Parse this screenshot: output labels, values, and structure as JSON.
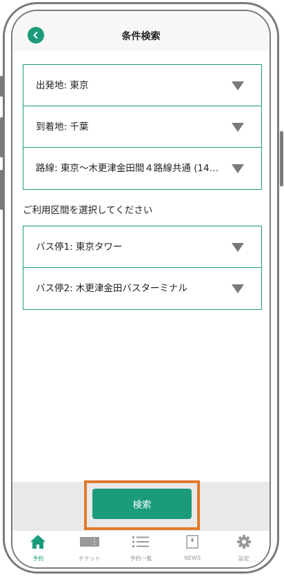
{
  "colors": {
    "primary": "#1a9b79",
    "highlight": "#e07a2a",
    "caret": "#7a7a7a",
    "inactive_tab": "#999999"
  },
  "header": {
    "title": "条件検索",
    "back_icon": "chevron-left-icon"
  },
  "route_selects": [
    {
      "label": "出発地: 東京"
    },
    {
      "label": "到着地: 千葉"
    },
    {
      "label": "路線: 東京～木更津金田間４路線共通 (14…"
    }
  ],
  "section": {
    "label": "ご利用区間を選択してください"
  },
  "stop_selects": [
    {
      "label": "バス停1: 東京タワー"
    },
    {
      "label": "バス停2: 木更津金田バスターミナル"
    }
  ],
  "search_button": {
    "label": "検索"
  },
  "tabs": [
    {
      "label": "予約",
      "icon": "home-icon",
      "active": true
    },
    {
      "label": "チケット",
      "icon": "ticket-icon",
      "active": false
    },
    {
      "label": "予約一覧",
      "icon": "list-icon",
      "active": false
    },
    {
      "label": "NEWS",
      "icon": "news-icon",
      "active": false
    },
    {
      "label": "設定",
      "icon": "gear-icon",
      "active": false
    }
  ]
}
